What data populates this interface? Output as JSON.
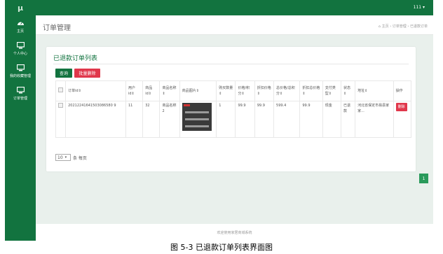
{
  "sidebar": {
    "logo": "μ",
    "items": [
      {
        "label": "主页",
        "icon": "dashboard-icon"
      },
      {
        "label": "个人中心",
        "icon": "monitor-icon"
      },
      {
        "label": "我的收藏管理",
        "icon": "monitor-icon"
      },
      {
        "label": "订单管理",
        "icon": "monitor-icon"
      }
    ]
  },
  "topbar": {
    "user": "111 ▾"
  },
  "header": {
    "title": "订单管理",
    "breadcrumb": [
      "主页",
      "订单管理",
      "已退款订单"
    ]
  },
  "panel": {
    "title": "已退款订单列表",
    "query_button": "查询",
    "batch_delete_button": "批量删除",
    "columns": [
      "订单id⇕",
      "用户id⇕",
      "商品id⇕",
      "商品名称⇕",
      "商品图片⇕",
      "购买数量⇕",
      "价格/积分⇕",
      "折扣价格⇕",
      "总价格/总积分⇕",
      "折扣总价格⇕",
      "支付类型⇕",
      "状态⇕",
      "地址⇕",
      "操作"
    ],
    "rows": [
      {
        "order_id": "20212241641503086580 9",
        "user_id": "11",
        "goods_id": "32",
        "goods_name": "商品名称2",
        "quantity": "1",
        "price": "99.9",
        "discount_price": "99.9",
        "total_price": "599.4",
        "discount_total": "99.9",
        "pay_type": "现金",
        "status": "已退款",
        "address": "河北省保定市易县家家...",
        "delete": "删除"
      }
    ],
    "page_size": "10",
    "per_page_label": "条 每页",
    "current_page": "1"
  },
  "footer": {
    "text": "欢迎使用家居商城系统"
  },
  "caption": "图 5-3 已退款订单列表界面图",
  "colors": {
    "primary": "#12733f",
    "danger": "#e0374b"
  }
}
